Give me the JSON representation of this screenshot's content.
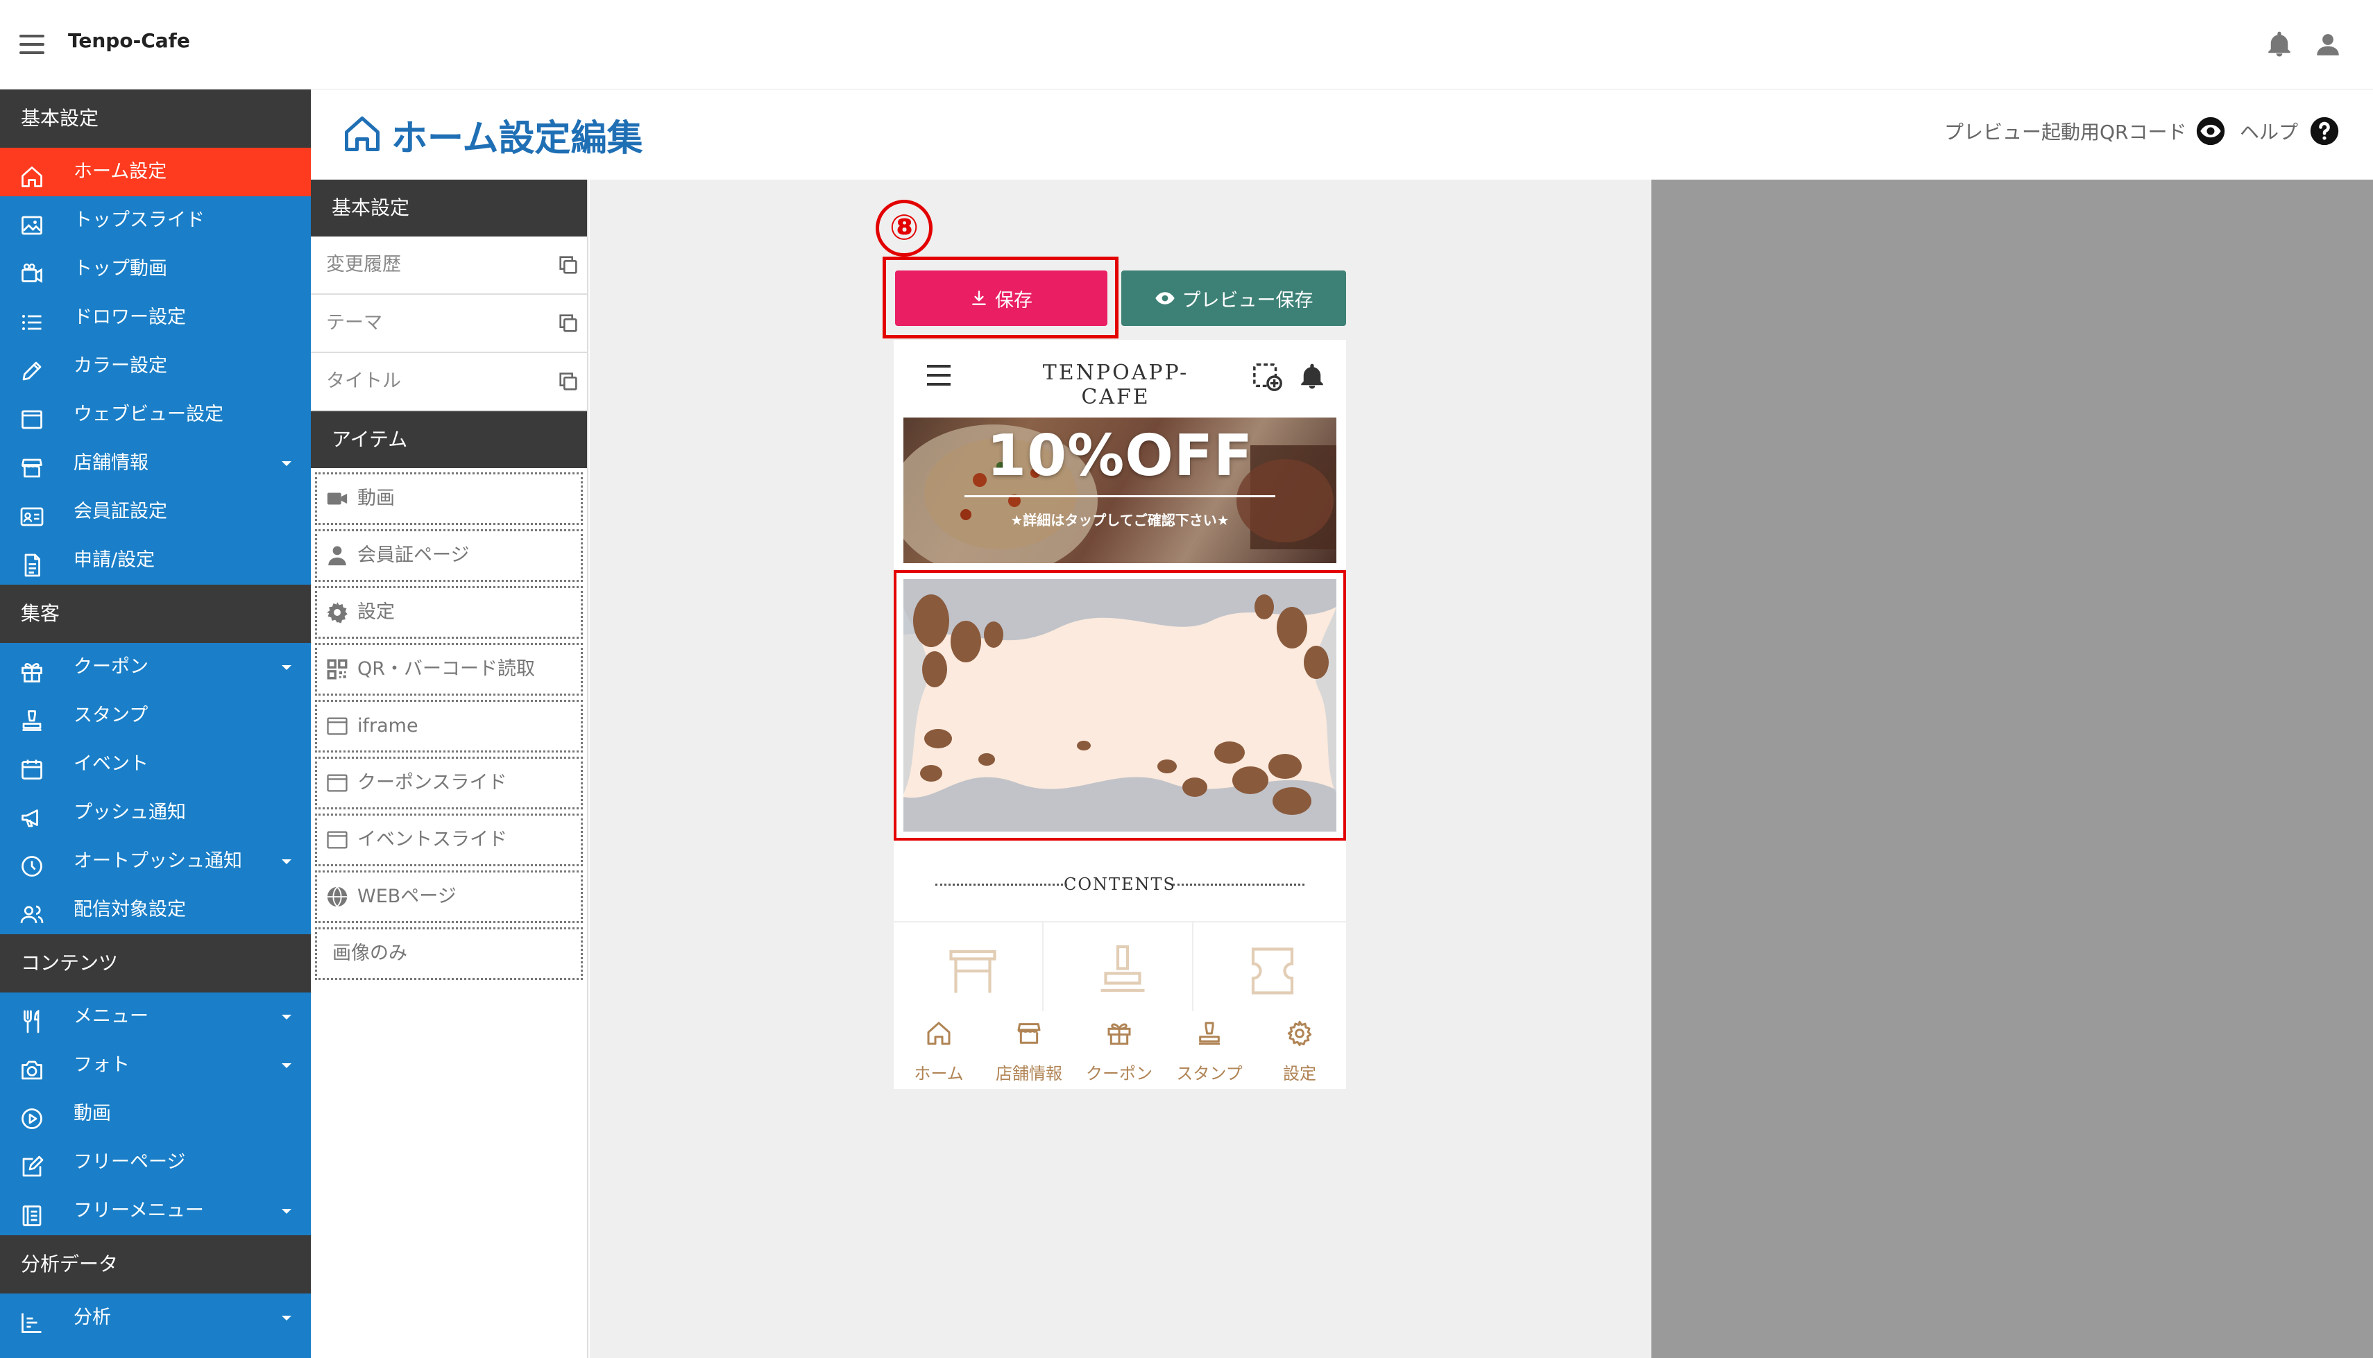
{
  "app": {
    "title": "Tenpo-Cafe"
  },
  "sidebar": {
    "sections": [
      {
        "label": "基本設定",
        "items": [
          {
            "label": "ホーム設定",
            "icon": "home-icon",
            "active": true
          },
          {
            "label": "トップスライド",
            "icon": "image-icon"
          },
          {
            "label": "トップ動画",
            "icon": "video-camera-icon"
          },
          {
            "label": "ドロワー設定",
            "icon": "list-icon"
          },
          {
            "label": "カラー設定",
            "icon": "pencil-icon"
          },
          {
            "label": "ウェブビュー設定",
            "icon": "browser-icon"
          },
          {
            "label": "店舗情報",
            "icon": "store-icon",
            "caret": true
          },
          {
            "label": "会員証設定",
            "icon": "id-card-icon"
          },
          {
            "label": "申請/設定",
            "icon": "document-icon"
          }
        ]
      },
      {
        "label": "集客",
        "items": [
          {
            "label": "クーポン",
            "icon": "gift-icon",
            "caret": true
          },
          {
            "label": "スタンプ",
            "icon": "stamp-icon"
          },
          {
            "label": "イベント",
            "icon": "calendar-icon"
          },
          {
            "label": "プッシュ通知",
            "icon": "megaphone-icon"
          },
          {
            "label": "オートプッシュ通知",
            "icon": "clock-icon",
            "caret": true
          },
          {
            "label": "配信対象設定",
            "icon": "users-icon"
          }
        ]
      },
      {
        "label": "コンテンツ",
        "items": [
          {
            "label": "メニュー",
            "icon": "fork-knife-icon",
            "caret": true
          },
          {
            "label": "フォト",
            "icon": "camera-icon",
            "caret": true
          },
          {
            "label": "動画",
            "icon": "play-icon"
          },
          {
            "label": "フリーページ",
            "icon": "edit-icon"
          },
          {
            "label": "フリーメニュー",
            "icon": "book-icon",
            "caret": true
          }
        ]
      },
      {
        "label": "分析データ",
        "items": [
          {
            "label": "分析",
            "icon": "chart-icon",
            "caret": true
          }
        ]
      }
    ]
  },
  "header": {
    "title": "ホーム設定編集",
    "qr_label": "プレビュー起動用QRコード",
    "help_label": "ヘルプ"
  },
  "panel": {
    "basic_head": "基本設定",
    "basic_rows": [
      "変更履歴",
      "テーマ",
      "タイトル"
    ],
    "items_head": "アイテム",
    "items": [
      {
        "label": "動画",
        "icon": "video-icon"
      },
      {
        "label": "会員証ページ",
        "icon": "person-icon"
      },
      {
        "label": "設定",
        "icon": "gear-icon"
      },
      {
        "label": "QR・バーコード読取",
        "icon": "qr-icon"
      },
      {
        "label": "iframe",
        "icon": "window-icon"
      },
      {
        "label": "クーポンスライド",
        "icon": "window-icon"
      },
      {
        "label": "イベントスライド",
        "icon": "window-icon"
      },
      {
        "label": "WEBページ",
        "icon": "globe-icon"
      },
      {
        "label": "画像のみ",
        "icon": ""
      }
    ]
  },
  "editor": {
    "step_marker": "⑧",
    "save_label": "保存",
    "preview_save_label": "プレビュー保存"
  },
  "phone": {
    "title": "TENPOAPP-CAFE",
    "banner_big": "10%OFF",
    "banner_sub": "★詳細はタップしてご確認下さい★",
    "contents_label": "CONTENTS",
    "tabs": [
      {
        "label": "ホーム",
        "icon": "home-icon"
      },
      {
        "label": "店舗情報",
        "icon": "store-icon"
      },
      {
        "label": "クーポン",
        "icon": "gift-icon"
      },
      {
        "label": "スタンプ",
        "icon": "stamp-icon"
      },
      {
        "label": "設定",
        "icon": "gear-icon"
      }
    ]
  },
  "colors": {
    "sidebar_blue": "#1a7fc8",
    "active_red": "#ff3b1f",
    "section_dark": "#3a3a3a",
    "save_pink": "#e91e63",
    "preview_green": "#3d8076",
    "title_blue": "#1f6fb5",
    "tab_gold": "#b08455"
  }
}
